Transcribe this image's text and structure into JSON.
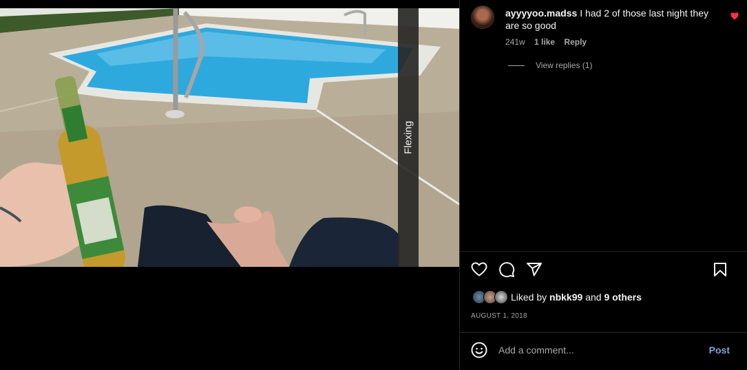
{
  "media": {
    "caption_overlay": "Flexing"
  },
  "comment": {
    "username": "ayyyyoo.madss",
    "text": "I had 2 of those last night they are so good",
    "time": "241w",
    "likes": "1 like",
    "reply_label": "Reply",
    "view_replies": "View replies (1)",
    "liked_color": "#ff3040"
  },
  "actions": {
    "icons": [
      "heart-icon",
      "comment-icon",
      "share-icon",
      "bookmark-icon"
    ]
  },
  "likes": {
    "prefix": "Liked by",
    "user": "nbkk99",
    "connector": "and",
    "others": "9 others"
  },
  "post_date": "AUGUST 1, 2018",
  "comment_box": {
    "placeholder": "Add a comment...",
    "post_label": "Post",
    "post_color": "#85a1d6"
  }
}
